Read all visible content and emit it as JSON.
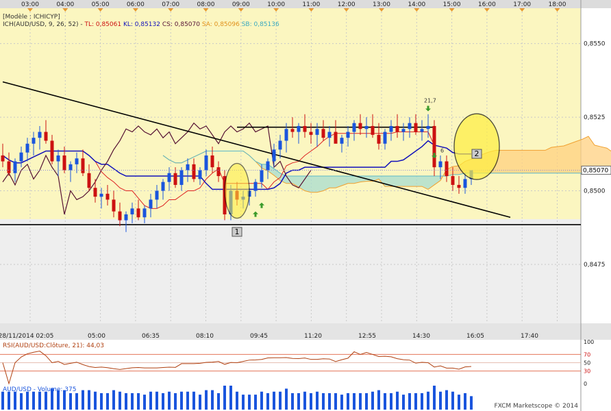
{
  "header": {
    "template": "[Modèle : ICHICYP]",
    "ichimoku_name": "ICH(AUD/USD, 9, 26, 52) -",
    "tl": "TL: 0,85061",
    "kl": "KL: 0,85132",
    "cs": "CS: 0,85070",
    "sa": "SA: 0,85096",
    "sb": "SB: 0,85136"
  },
  "top_time_labels": [
    "03:00",
    "04:00",
    "05:00",
    "06:00",
    "07:00",
    "08:00",
    "09:00",
    "10:00",
    "11:00",
    "12:00",
    "13:00",
    "14:00",
    "15:00",
    "16:00",
    "17:00",
    "18:00"
  ],
  "bottom_time_labels": [
    "28/11/2014 02:05",
    "05:00",
    "06:35",
    "08:10",
    "09:45",
    "11:20",
    "12:55",
    "14:30",
    "16:05",
    "17:40"
  ],
  "price_axis": {
    "ticks": [
      "0,8550",
      "0,8525",
      "0,8500",
      "0,8475"
    ],
    "current": "0,85070"
  },
  "annotations": {
    "circle1": "1",
    "circle2": "2",
    "label_a": "21,7",
    "label_b": "6"
  },
  "rsi": {
    "title": "RSI(AUD/USD:Clôture, 21): 44,03",
    "levels": [
      "100",
      "70",
      "50",
      "30",
      "0"
    ]
  },
  "volume": {
    "title": "AUD/USD - Volume: 375"
  },
  "footer": {
    "brand": "FXCM Marketscope © 2014"
  },
  "colors": {
    "main_bg": "#fbf6c0",
    "panel_bg": "#eeeeee",
    "bull": "#1a55dd",
    "bear": "#cc1111",
    "tenkan": "#dd2222",
    "kijun": "#1111bb",
    "chikou": "#551133",
    "senkou_a": "#f0a030",
    "senkou_b": "#5ab8c8",
    "cloud_bull": "#ffd080",
    "cloud_bear": "#a8dcd0",
    "rsi": "#b04010",
    "volume": "#1a55dd"
  },
  "chart_data": {
    "type": "candlestick",
    "symbol": "AUD/USD",
    "period": "5 min",
    "ylim": [
      0.8455,
      0.8562
    ],
    "ohlc": [
      [
        0.8512,
        0.8516,
        0.8508,
        0.851
      ],
      [
        0.851,
        0.8513,
        0.8505,
        0.8506
      ],
      [
        0.8506,
        0.8511,
        0.8503,
        0.851
      ],
      [
        0.851,
        0.8515,
        0.8508,
        0.8513
      ],
      [
        0.8513,
        0.8518,
        0.851,
        0.8516
      ],
      [
        0.8516,
        0.852,
        0.8512,
        0.8518
      ],
      [
        0.8518,
        0.8522,
        0.8514,
        0.852
      ],
      [
        0.852,
        0.8524,
        0.8516,
        0.8517
      ],
      [
        0.8517,
        0.8519,
        0.8509,
        0.851
      ],
      [
        0.851,
        0.8514,
        0.8505,
        0.8512
      ],
      [
        0.8512,
        0.8515,
        0.8506,
        0.8507
      ],
      [
        0.8507,
        0.851,
        0.8503,
        0.8509
      ],
      [
        0.8509,
        0.8513,
        0.8506,
        0.8511
      ],
      [
        0.8511,
        0.8514,
        0.8505,
        0.8506
      ],
      [
        0.8506,
        0.8509,
        0.85,
        0.8501
      ],
      [
        0.8501,
        0.8504,
        0.8496,
        0.8498
      ],
      [
        0.8498,
        0.8501,
        0.8494,
        0.8499
      ],
      [
        0.8499,
        0.8502,
        0.8495,
        0.8497
      ],
      [
        0.8497,
        0.85,
        0.8491,
        0.8493
      ],
      [
        0.8493,
        0.8496,
        0.8488,
        0.849
      ],
      [
        0.849,
        0.8493,
        0.8486,
        0.8492
      ],
      [
        0.8492,
        0.8496,
        0.8489,
        0.8494
      ],
      [
        0.8494,
        0.8497,
        0.849,
        0.8491
      ],
      [
        0.8491,
        0.8495,
        0.8489,
        0.8494
      ],
      [
        0.8494,
        0.8499,
        0.8491,
        0.8497
      ],
      [
        0.8497,
        0.8502,
        0.8494,
        0.85
      ],
      [
        0.85,
        0.8504,
        0.8497,
        0.8503
      ],
      [
        0.8503,
        0.8508,
        0.85,
        0.8506
      ],
      [
        0.8506,
        0.8508,
        0.8501,
        0.8502
      ],
      [
        0.8502,
        0.8508,
        0.85,
        0.8507
      ],
      [
        0.8507,
        0.8511,
        0.8503,
        0.8509
      ],
      [
        0.8509,
        0.8511,
        0.8503,
        0.8504
      ],
      [
        0.8504,
        0.8508,
        0.8502,
        0.8507
      ],
      [
        0.8507,
        0.8514,
        0.8505,
        0.8512
      ],
      [
        0.8512,
        0.8515,
        0.8506,
        0.8508
      ],
      [
        0.8508,
        0.851,
        0.8503,
        0.8505
      ],
      [
        0.8505,
        0.8507,
        0.849,
        0.8492
      ],
      [
        0.8492,
        0.8502,
        0.849,
        0.85
      ],
      [
        0.85,
        0.8503,
        0.8495,
        0.8497
      ],
      [
        0.8497,
        0.85,
        0.8494,
        0.8498
      ],
      [
        0.8498,
        0.8501,
        0.8495,
        0.85
      ],
      [
        0.85,
        0.8504,
        0.8498,
        0.8503
      ],
      [
        0.8503,
        0.8509,
        0.8501,
        0.8507
      ],
      [
        0.8507,
        0.8511,
        0.8504,
        0.851
      ],
      [
        0.851,
        0.8516,
        0.8508,
        0.8514
      ],
      [
        0.8514,
        0.8519,
        0.8511,
        0.8517
      ],
      [
        0.8517,
        0.8523,
        0.8513,
        0.8521
      ],
      [
        0.8521,
        0.8525,
        0.8518,
        0.852
      ],
      [
        0.852,
        0.8523,
        0.8516,
        0.8522
      ],
      [
        0.8522,
        0.8526,
        0.8518,
        0.852
      ],
      [
        0.852,
        0.8523,
        0.8516,
        0.8519
      ],
      [
        0.8519,
        0.8523,
        0.8515,
        0.8521
      ],
      [
        0.8521,
        0.8524,
        0.8517,
        0.8518
      ],
      [
        0.8518,
        0.8522,
        0.8515,
        0.852
      ],
      [
        0.852,
        0.8524,
        0.8517,
        0.8516
      ],
      [
        0.8516,
        0.8519,
        0.8513,
        0.8518
      ],
      [
        0.8518,
        0.8522,
        0.8515,
        0.852
      ],
      [
        0.852,
        0.8524,
        0.8517,
        0.8523
      ],
      [
        0.8523,
        0.8526,
        0.8519,
        0.8521
      ],
      [
        0.8521,
        0.8525,
        0.8518,
        0.8522
      ],
      [
        0.8522,
        0.8526,
        0.8518,
        0.8519
      ],
      [
        0.8519,
        0.8523,
        0.8514,
        0.8516
      ],
      [
        0.8516,
        0.8521,
        0.8514,
        0.852
      ],
      [
        0.852,
        0.8524,
        0.8517,
        0.8522
      ],
      [
        0.8522,
        0.8526,
        0.8518,
        0.852
      ],
      [
        0.852,
        0.8523,
        0.8517,
        0.8521
      ],
      [
        0.8521,
        0.8525,
        0.8518,
        0.8523
      ],
      [
        0.8523,
        0.8526,
        0.8519,
        0.852
      ],
      [
        0.852,
        0.8524,
        0.8517,
        0.8521
      ],
      [
        0.8521,
        0.8526,
        0.8518,
        0.8522
      ],
      [
        0.8522,
        0.8524,
        0.8505,
        0.8508
      ],
      [
        0.8508,
        0.8512,
        0.8504,
        0.851
      ],
      [
        0.851,
        0.8512,
        0.8503,
        0.8505
      ],
      [
        0.8505,
        0.8508,
        0.85,
        0.8502
      ],
      [
        0.8502,
        0.8505,
        0.8499,
        0.8501
      ],
      [
        0.8501,
        0.8506,
        0.8499,
        0.8504
      ],
      [
        0.8504,
        0.8507,
        0.8502,
        0.8507
      ]
    ],
    "horizontal_lines": [
      0.85216,
      0.84885
    ],
    "trendline": [
      [
        0,
        0.8537
      ],
      [
        69,
        0.8491
      ]
    ],
    "annotations": [
      {
        "text": "1"
      },
      {
        "text": "2"
      },
      {
        "text": "21,7"
      },
      {
        "text": "6"
      }
    ],
    "rsi": {
      "period": 21,
      "value": 44.03,
      "levels": [
        30,
        50,
        70
      ],
      "ylim": [
        0,
        100
      ]
    },
    "volume": {
      "last": 375
    }
  }
}
